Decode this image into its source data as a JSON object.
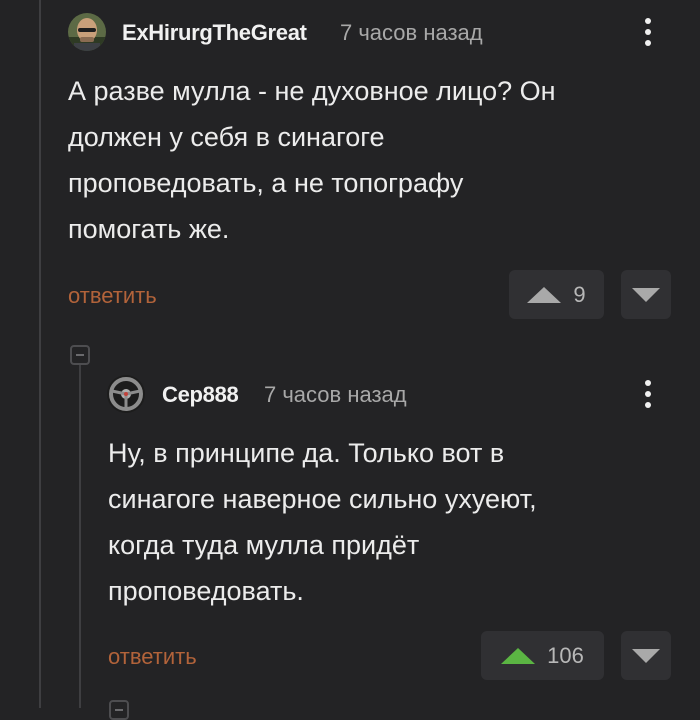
{
  "comments": [
    {
      "author": "ExHirurgTheGreat",
      "time": "7 часов назад",
      "text": "А разве мулла - не духовное лицо? Он должен у себя в синагоге проповедовать, а не топографу помогать же.",
      "lines": [
        "А разве мулла - не духовное лицо? Он",
        "должен у себя в синагоге",
        "проповедовать, а не топографу",
        "помогать же."
      ],
      "reply_label": "ответить",
      "rating": "9",
      "upvote_active": false,
      "avatar_icon": "bald-man-sunglasses-avatar"
    },
    {
      "author": "Cep888",
      "time": "7 часов назад",
      "text": "Ну, в принципе да. Только вот в синагоге наверное сильно ухуеют, когда туда мулла придёт проповедовать.",
      "lines": [
        "Ну, в принципе да. Только вот в",
        "синагоге наверное сильно ухуеют,",
        "когда туда мулла придёт",
        "проповедовать."
      ],
      "reply_label": "ответить",
      "rating": "106",
      "upvote_active": true,
      "avatar_icon": "steering-wheel-avatar"
    }
  ],
  "colors": {
    "background": "#232325",
    "reply_link": "#b2633a",
    "upvote_active": "#5bb543",
    "vote_box": "#303033"
  }
}
